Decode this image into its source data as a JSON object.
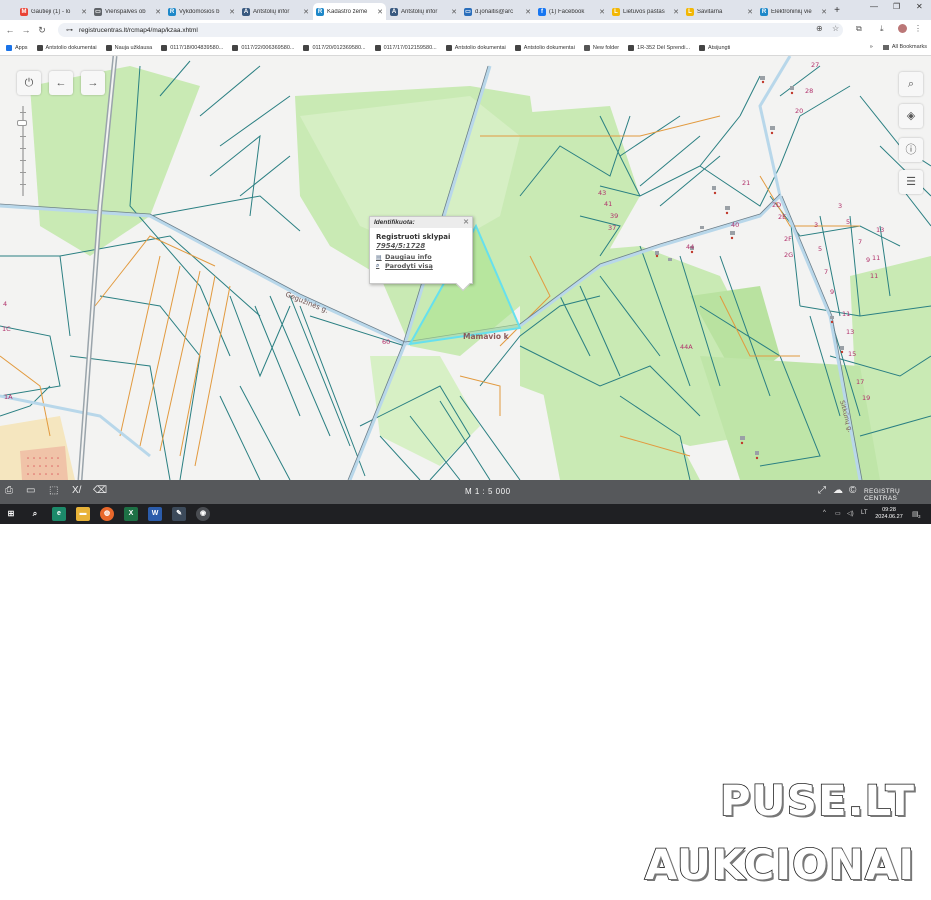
{
  "browser": {
    "tabs": [
      {
        "label": "Gautieji (1) - lo",
        "fav": "M",
        "color": "#ea4335"
      },
      {
        "label": "Vienspalvės ob",
        "fav": "▭",
        "color": "#5f6368"
      },
      {
        "label": "Vykdomosios b",
        "fav": "R",
        "color": "#1e88c9"
      },
      {
        "label": "Antstolių infor",
        "fav": "A",
        "color": "#3a5a80"
      },
      {
        "label": "Kadastro žemė",
        "fav": "R",
        "color": "#1e88c9",
        "active": true
      },
      {
        "label": "Antstolių infor",
        "fav": "A",
        "color": "#3a5a80"
      },
      {
        "label": "d.jonaitis@arc",
        "fav": "▭",
        "color": "#2a6ebb"
      },
      {
        "label": "(1) Facebook",
        "fav": "f",
        "color": "#1877f2"
      },
      {
        "label": "Lietuvos paštas",
        "fav": "L",
        "color": "#f2b705"
      },
      {
        "label": "Savitarna",
        "fav": "L",
        "color": "#f2b705"
      },
      {
        "label": "Elektroninių vie",
        "fav": "R",
        "color": "#1e88c9"
      }
    ],
    "url": "registrucentras.lt/rcmap4/map/kzaa.xhtml",
    "bookmarks": [
      {
        "label": "Apps",
        "icon": "grid-icon"
      },
      {
        "label": "Antstolio dokumentai",
        "icon": "doc-icon"
      },
      {
        "label": "Nauja užklausa",
        "icon": "doc-icon"
      },
      {
        "label": "0117/18/004839580...",
        "icon": "doc-icon"
      },
      {
        "label": "0117/22/006369580...",
        "icon": "doc-icon"
      },
      {
        "label": "0117/20/012369580...",
        "icon": "doc-icon"
      },
      {
        "label": "0117/17/012159580...",
        "icon": "doc-icon"
      },
      {
        "label": "Antstolio dokumentai",
        "icon": "doc-icon"
      },
      {
        "label": "Antstolio dokumentai",
        "icon": "doc-icon"
      },
      {
        "label": "New folder",
        "icon": "folder-icon"
      },
      {
        "label": "1R-352 Dėl Sprendi...",
        "icon": "doc-icon"
      },
      {
        "label": "Atsijungti",
        "icon": "doc-icon"
      }
    ],
    "all_bookmarks": "All Bookmarks"
  },
  "map": {
    "popup": {
      "title": "Identifikuota:",
      "subtitle": "Registruoti sklypai",
      "parcel_number": "7954/5:1728",
      "more_info": "Daugiau info",
      "show_all": "Parodyti visą"
    },
    "street_labels": {
      "main_road": "Gegužinės g.",
      "side_road": "Mamavio k",
      "right_road": "Sitkūnų g."
    },
    "lot_labels": [
      "43",
      "41",
      "39",
      "37",
      "44",
      "40",
      "2D",
      "2E",
      "2F",
      "2G",
      "3",
      "5",
      "7",
      "9",
      "11",
      "13",
      "15",
      "17",
      "19",
      "44A",
      "60",
      "28",
      "20",
      "27",
      "21",
      "13",
      "3",
      "5",
      "7",
      "9",
      "11",
      "11",
      "4",
      "1C",
      "1A"
    ],
    "scale": "M 1 : 5 000",
    "brand": "REGISTRŲ CENTRAS",
    "highlight_color": "#66e0ee",
    "parcel_line_color": "#1f7a7a",
    "orange_line_color": "#e8a040"
  },
  "taskbar": {
    "time": "09:28",
    "date": "2024.06.27",
    "lang": "LT",
    "notif_count": "3"
  },
  "watermark": {
    "line1": "PUSE.LT",
    "line2": "AUKCIONAI"
  }
}
